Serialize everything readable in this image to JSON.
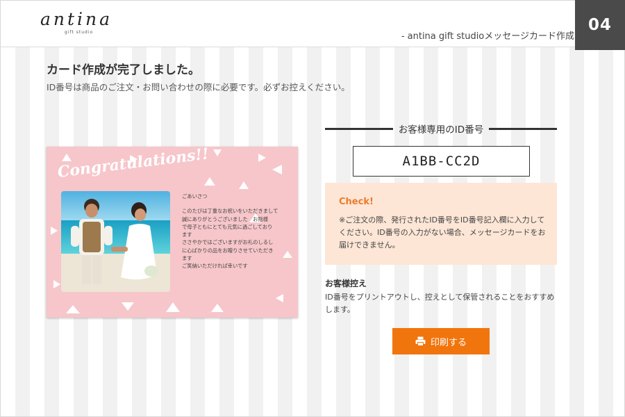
{
  "header": {
    "logo_text": "antina",
    "logo_sub": "gift studio",
    "title": "- antina gift studioメッセージカード作成",
    "step_badge": "04"
  },
  "completion": {
    "title": "カード作成が完了しました。",
    "note": "ID番号は商品のご注文・お問い合わせの際に必要です。必ずお控えください。"
  },
  "card_preview": {
    "headline": "Congratulations!!",
    "greeting": "ごあいさつ",
    "message_lines": [
      "このたびは丁重なお祝いをいただきまして",
      "誠にありがとうございました　お陰様",
      "で母子ともにとても元気に過ごしており",
      "ます",
      "ささやかではございますがお礼のしるし",
      "に心ばかりの品をお贈りさせていただき",
      "ます",
      "ご笑納いただければ幸いです"
    ],
    "background_color": "#f6c6ca"
  },
  "id_section": {
    "heading": "お客様専用のID番号",
    "id_value": "A1BB-CC2D"
  },
  "check": {
    "title": "Check!",
    "body": "※ご注文の際、発行されたID番号をID番号記入欄に入力してください。ID番号の入力がない場合、メッセージカードをお届けできません。"
  },
  "customer_copy": {
    "title": "お客様控え",
    "body": "ID番号をプリントアウトし、控えとして保管されることをおすすめします。"
  },
  "print_button": {
    "label": "印刷する",
    "icon": "printer-icon",
    "color": "#f1750d"
  },
  "colors": {
    "accent_orange": "#f1750d",
    "check_bg": "#fde6d6",
    "badge_bg": "#4a4a4a"
  }
}
